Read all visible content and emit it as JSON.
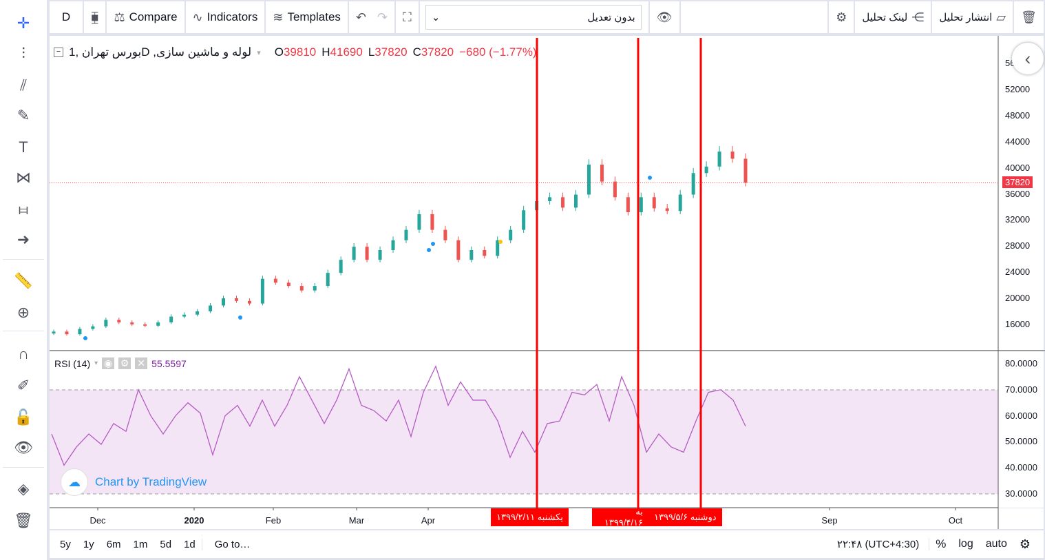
{
  "left_toolbar": {
    "icons": [
      "crosshair-icon",
      "vertical-line-icon",
      "trend-lines-icon",
      "brush-icon",
      "text-icon",
      "pattern-icon",
      "prediction-icon",
      "arrow-icon",
      "ruler-icon",
      "zoom-in-icon",
      "magnet-icon",
      "lock-drawing-icon",
      "unlock-icon",
      "eye-icon",
      "layers-icon",
      "trash-icon"
    ]
  },
  "toolbar": {
    "interval": "D",
    "compare": "Compare",
    "indicators": "Indicators",
    "templates": "Templates",
    "adjustment_select": "بدون تعدیل",
    "share_link": "لینک تحلیل",
    "publish": "انتشار تحلیل"
  },
  "legend": {
    "symbol": "بورس تهران ,1D ,لوله و ماشین سازی",
    "o_label": "O",
    "o": "39810",
    "h_label": "H",
    "h": "41690",
    "l_label": "L",
    "l": "37820",
    "c_label": "C",
    "c": "37820",
    "change": "−680 (−1.77%)"
  },
  "rsi_legend": {
    "name": "RSI (14)",
    "value": "55.5597"
  },
  "watermark": "Chart by TradingView",
  "price_axis": {
    "ticks": [
      "56000",
      "52000",
      "48000",
      "44000",
      "40000",
      "36000",
      "32000",
      "28000",
      "24000",
      "20000",
      "16000"
    ],
    "last_price": "37820"
  },
  "rsi_axis": {
    "ticks": [
      "80.0000",
      "70.0000",
      "60.0000",
      "50.0000",
      "40.0000",
      "30.0000"
    ]
  },
  "time_axis": {
    "ticks": [
      "Dec",
      "2020",
      "Feb",
      "Mar",
      "Apr",
      "Sep",
      "Oct"
    ]
  },
  "vertical_line_labels": [
    "یکشنبه ۱۳۹۹/۲/۱۱",
    "به ۱۳۹۹/۴/۱۶",
    "دوشنبه ۱۳۹۹/۵/۶"
  ],
  "bottom_bar": {
    "ranges": [
      "5y",
      "1y",
      "6m",
      "1m",
      "5d",
      "1d"
    ],
    "goto": "Go to…",
    "time": "۲۲:۴۸ (UTC+4:30)",
    "percent": "%",
    "log": "log",
    "auto": "auto"
  },
  "colors": {
    "up": "#26a69a",
    "down": "#ef5350",
    "rsi_line": "#b45cc3",
    "rsi_band": "#f3e5f5",
    "marker": "#ff0000"
  },
  "chart_data": [
    {
      "type": "candlestick",
      "ylim": [
        14000,
        58000
      ],
      "closes": [
        15000,
        14600,
        15400,
        15800,
        16800,
        16400,
        16100,
        15900,
        16400,
        17300,
        17600,
        18100,
        19000,
        20100,
        19700,
        19300,
        23100,
        22500,
        22000,
        21300,
        22000,
        24000,
        26000,
        28000,
        26000,
        27500,
        29000,
        30600,
        33000,
        30600,
        29000,
        26000,
        27500,
        26600,
        29000,
        30600,
        33600,
        35000,
        35600,
        34000,
        36000,
        40600,
        38000,
        35600,
        33300,
        35600,
        33900,
        33500,
        36000,
        39300,
        40300,
        42600,
        41500,
        37820
      ]
    },
    {
      "type": "line",
      "name": "RSI (14)",
      "ylim": [
        27,
        82
      ],
      "bands": [
        30,
        70
      ],
      "values": [
        53,
        41,
        48,
        53,
        49,
        57,
        54,
        70,
        60,
        53,
        60,
        65,
        61,
        45,
        60,
        64,
        56,
        66,
        56,
        64,
        75,
        66,
        57,
        66,
        78,
        64,
        62,
        58,
        66,
        52,
        69,
        79,
        64,
        73,
        66,
        66,
        58,
        44,
        54,
        46,
        57,
        58,
        69,
        68,
        72,
        58,
        75,
        64,
        46,
        53,
        48,
        46,
        58,
        69,
        70,
        66,
        56
      ]
    }
  ]
}
